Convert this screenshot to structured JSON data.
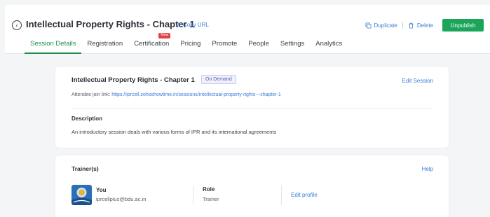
{
  "header": {
    "title": "Intellectual Property Rights - Chapter 1",
    "copy_url_label": "Copy URL",
    "duplicate_label": "Duplicate",
    "delete_label": "Delete",
    "unpublish_label": "Unpublish"
  },
  "tabs": [
    {
      "label": "Session Details",
      "active": true
    },
    {
      "label": "Registration"
    },
    {
      "label": "Certification",
      "badge": "New"
    },
    {
      "label": "Pricing"
    },
    {
      "label": "Promote"
    },
    {
      "label": "People"
    },
    {
      "label": "Settings"
    },
    {
      "label": "Analytics"
    }
  ],
  "session": {
    "title": "Intellectual Property Rights - Chapter 1",
    "type_badge": "On Demand",
    "edit_label": "Edit Session",
    "join_link_label": "Attendee join link:",
    "join_link_url": "https://iprcell.zohoshowtime.in/sessions/intellectual-property-rights---chapter-1",
    "description_label": "Description",
    "description_text": "An introductory session deals with various forms of IPR and its international agreements"
  },
  "trainers": {
    "section_label": "Trainer(s)",
    "help_label": "Help",
    "items": [
      {
        "name": "You",
        "email": "iprcellplus@bdu.ac.in",
        "role_label": "Role",
        "role_value": "Trainer",
        "edit_profile_label": "Edit profile"
      }
    ]
  },
  "colors": {
    "accent_green": "#1aa559",
    "link_blue": "#3b7dd8",
    "badge_red": "#e2414c",
    "background": "#f4f5f7"
  },
  "icons": {
    "back": "circle-back-icon",
    "copy_url": "link-icon",
    "duplicate": "duplicate-icon",
    "delete": "trash-icon"
  }
}
